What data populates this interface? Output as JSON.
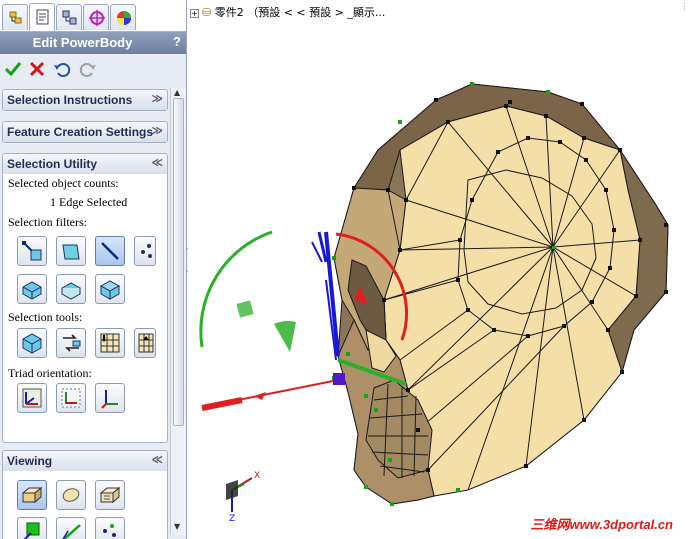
{
  "property_manager": {
    "title": "Edit PowerBody",
    "help": "?",
    "tabs": [
      "feature-manager-tab",
      "property-manager-tab",
      "configuration-manager-tab",
      "dimxpert-tab",
      "display-manager-tab"
    ],
    "actions": {
      "ok": "✔",
      "cancel": "✖",
      "undo": "↶",
      "redo": "↷"
    }
  },
  "groups": {
    "selection_instructions": {
      "label": "Selection Instructions",
      "chevron": "≫"
    },
    "feature_creation_settings": {
      "label": "Feature Creation Settings",
      "chevron": "≫"
    },
    "selection_utility": {
      "label": "Selection Utility",
      "chevron": "≪",
      "counts_label": "Selected object counts:",
      "counts_value": "1 Edge Selected",
      "filters_label": "Selection filters:",
      "tools_label": "Selection tools:",
      "triad_label": "Triad orientation:"
    },
    "viewing": {
      "label": "Viewing",
      "chevron": "≪"
    }
  },
  "viewport": {
    "tree_label": "零件2 （預設 < < 預設 > _顯示...",
    "watermark": "三维网www.3dportal.cn",
    "triad_axes": {
      "x": "X",
      "y": "Y",
      "z": "Z"
    }
  },
  "colors": {
    "panel_bg": "#e7ebf4",
    "title_bar": "#7b8cab",
    "model_face": "#f3dca7",
    "model_dark": "#8b7558",
    "manipulator_red": "#e02020",
    "manipulator_green": "#2ab02a",
    "manipulator_blue": "#1818d8",
    "watermark_red": "#e01818"
  }
}
